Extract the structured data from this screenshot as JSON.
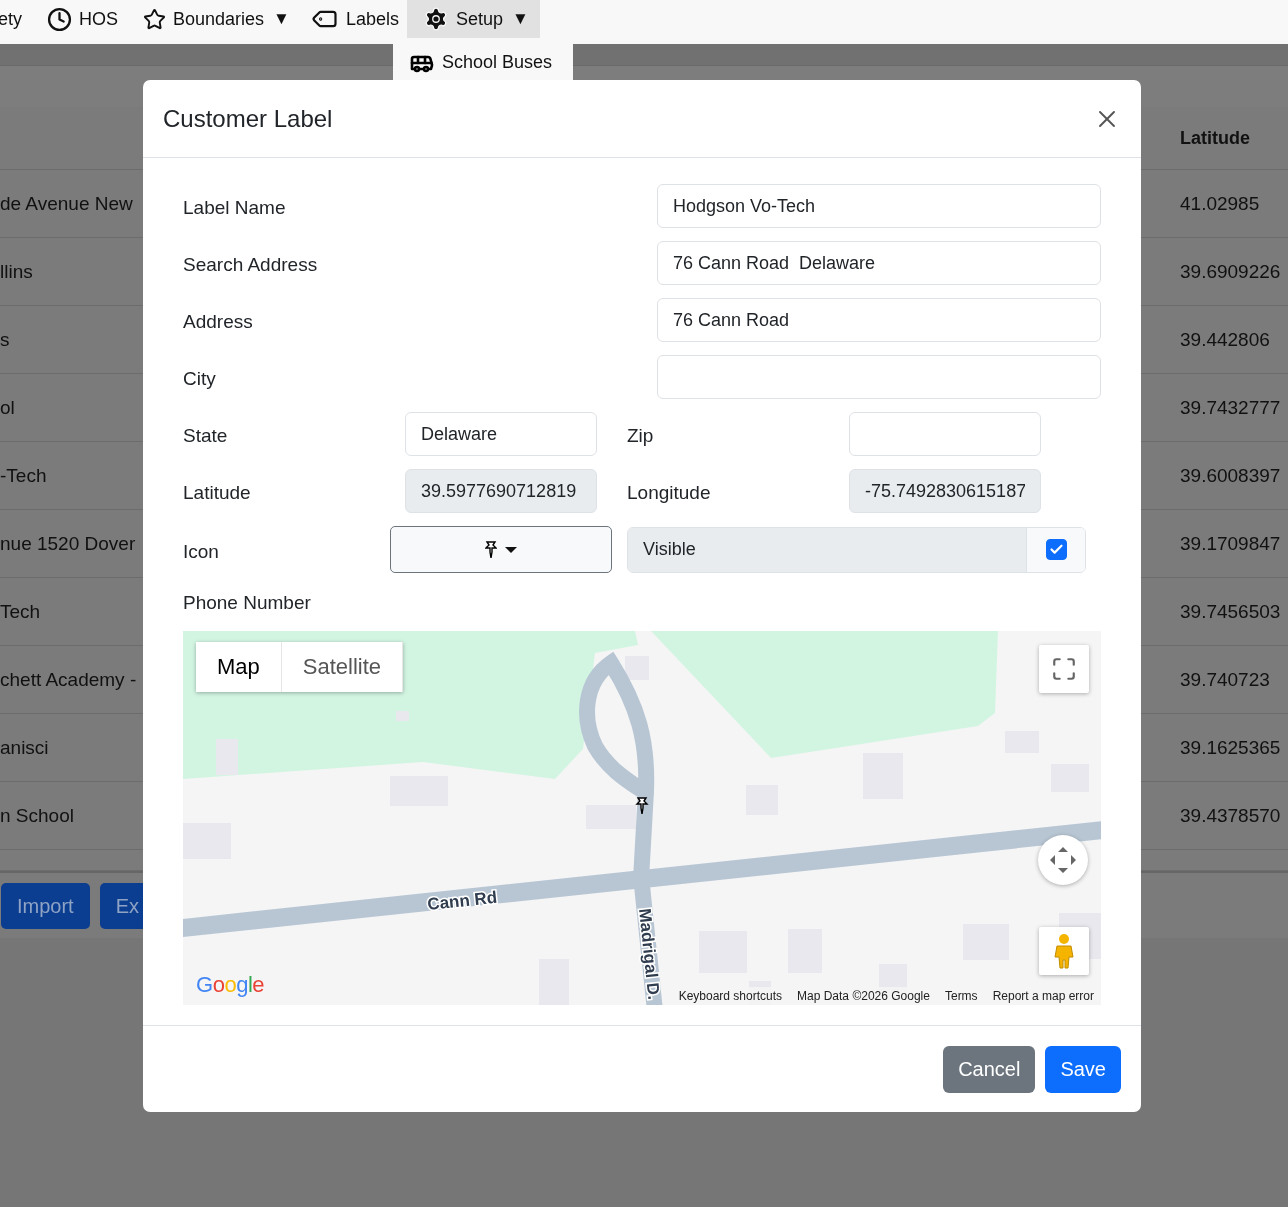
{
  "nav": {
    "items": [
      {
        "label": "ety",
        "selected": false
      },
      {
        "label": "HOS",
        "selected": false
      },
      {
        "label": "Boundaries",
        "caret": "▼",
        "selected": false
      },
      {
        "label": "Labels",
        "selected": false
      },
      {
        "label": "Setup",
        "caret": "▼",
        "selected": true
      }
    ],
    "dropdown": [
      {
        "label": "School Buses"
      }
    ]
  },
  "table": {
    "latitude_header": "Latitude",
    "rows": [
      {
        "column_1": "de Avenue New",
        "latitude": "41.02985"
      },
      {
        "column_1": "llins",
        "latitude": "39.6909226"
      },
      {
        "column_1": "s",
        "latitude": "39.442806"
      },
      {
        "column_1": "ol",
        "latitude": "39.7432777"
      },
      {
        "column_1": "-Tech",
        "latitude": "39.6008397"
      },
      {
        "column_1": "nue 1520 Dover",
        "latitude": "39.1709847"
      },
      {
        "column_1": "Tech",
        "latitude": "39.7456503"
      },
      {
        "column_1": "chett Academy -",
        "latitude": "39.740723"
      },
      {
        "column_1": "anisci",
        "latitude": "39.1625365"
      },
      {
        "column_1": "n School",
        "latitude": "39.4378570"
      }
    ],
    "buttons": [
      "Import",
      "Ex"
    ]
  },
  "modal": {
    "title": "Customer Label",
    "rows": [
      {
        "kind": "text",
        "label": "Label Name",
        "value": "Hodgson Vo-Tech"
      },
      {
        "kind": "text",
        "label": "Search Address",
        "value": "76 Cann Road  Delaware"
      },
      {
        "kind": "text",
        "label": "Address",
        "value": "76 Cann Road"
      },
      {
        "kind": "text",
        "label": "City"
      },
      {
        "kind": "pair",
        "fields": [
          {
            "label": "State",
            "value": "Delaware",
            "readonly": false
          },
          {
            "label": "Zip",
            "readonly": false
          }
        ]
      },
      {
        "kind": "pair",
        "fields": [
          {
            "label": "Latitude",
            "value": "39.5977690712819",
            "readonly": true
          },
          {
            "label": "Longitude",
            "value": "-75.7492830615187",
            "readonly": true
          }
        ]
      },
      {
        "kind": "icon",
        "label": "Icon",
        "visible": {
          "label": "Visible",
          "checked": true
        }
      },
      {
        "kind": "label",
        "label": "Phone Number"
      }
    ],
    "map": {
      "map_types": [
        {
          "label": "Map",
          "selected": true
        },
        {
          "label": "Satellite",
          "selected": false
        }
      ],
      "road_labels": [
        "Cann Rd",
        "Madrigal D."
      ],
      "logo": "Google",
      "attribution": [
        "Keyboard shortcuts",
        "Map Data ©2026 Google",
        "Terms",
        "Report a map error"
      ]
    },
    "buttons": [
      {
        "label": "Cancel",
        "kind": "secondary"
      },
      {
        "label": "Save",
        "kind": "primary"
      }
    ]
  }
}
